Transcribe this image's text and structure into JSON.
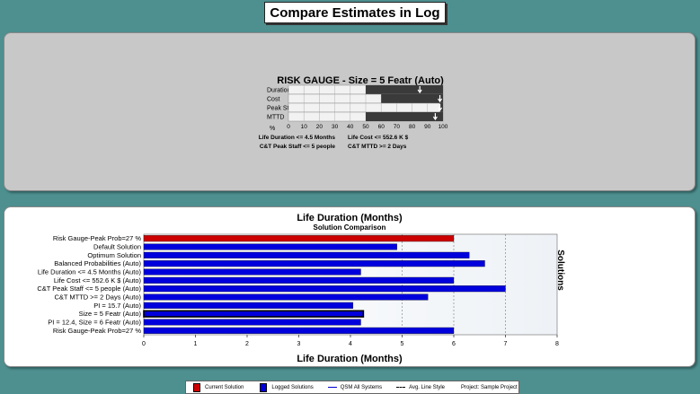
{
  "window": {
    "title": "Compare Estimates in Log"
  },
  "gauge": {
    "title": "RISK GAUGE - Size = 5 Featr (Auto)",
    "rows": [
      {
        "label": "Duration",
        "value": 50,
        "marker": 85
      },
      {
        "label": "Cost",
        "value": 60,
        "marker": 98
      },
      {
        "label": "Peak Staff",
        "value": 98,
        "marker": 98
      },
      {
        "label": "MTTD",
        "value": 50,
        "marker": 95
      }
    ],
    "axis_label": "%",
    "ticks": [
      "0",
      "10",
      "20",
      "30",
      "40",
      "50",
      "60",
      "70",
      "80",
      "90",
      "100"
    ],
    "constraints": [
      [
        "Life Duration  <=  4.5 Months",
        "Life Cost  <=  552.6 K $"
      ],
      [
        "C&T Peak Staff  <=  5 people",
        "C&T MTTD  >=  2 Days"
      ]
    ],
    "colors": {
      "filled": "#3a3a3a",
      "empty": "#f2f2f2",
      "grid": "#b0b0b0"
    }
  },
  "chart_data": {
    "type": "bar",
    "orientation": "horizontal",
    "title": "Life Duration (Months)",
    "subtitle": "Solution Comparison",
    "xlabel": "Life Duration (Months)",
    "ylabel": "Solutions",
    "xlim": [
      0,
      8
    ],
    "xticks": [
      "0",
      "1",
      "2",
      "3",
      "4",
      "5",
      "6",
      "7",
      "8"
    ],
    "grid_x": [
      5,
      6,
      7
    ],
    "avg_line": 5,
    "categories": [
      "Risk Gauge-Peak Prob=27 %",
      "Default Solution",
      "Optimum Solution",
      "Balanced Probabilities (Auto)",
      "Life Duration  <=  4.5 Months (Auto)",
      "Life Cost  <=  552.6 K $ (Auto)",
      "C&T Peak Staff  <=  5 people (Auto)",
      "C&T MTTD  >=  2 Days (Auto)",
      "PI = 15.7 (Auto)",
      "Size = 5 Featr (Auto)",
      "PI = 12.4, Size = 6 Featr (Auto)",
      "Risk Gauge-Peak Prob=27 %"
    ],
    "values": [
      6.0,
      4.9,
      6.3,
      6.6,
      4.2,
      6.0,
      7.0,
      5.5,
      4.05,
      4.25,
      4.2,
      6.0
    ],
    "bar_colors": [
      "#cc0000",
      "#0000dd",
      "#0000dd",
      "#0000dd",
      "#0000dd",
      "#0000dd",
      "#0000dd",
      "#0000dd",
      "#0000dd",
      "#0000dd",
      "#0000dd",
      "#0000dd"
    ],
    "selected_index": 9
  },
  "legend": {
    "items": [
      {
        "label": "Current Solution",
        "kind": "swatch",
        "color": "#cc0000"
      },
      {
        "label": "Logged Solutions",
        "kind": "swatch",
        "color": "#0000dd"
      },
      {
        "label": "QSM All Systems",
        "kind": "line",
        "color": "#0000cc"
      },
      {
        "label": "Avg. Line Style",
        "kind": "line",
        "color": "#000000"
      },
      {
        "label": "Project: Sample Project",
        "kind": "text"
      }
    ]
  }
}
